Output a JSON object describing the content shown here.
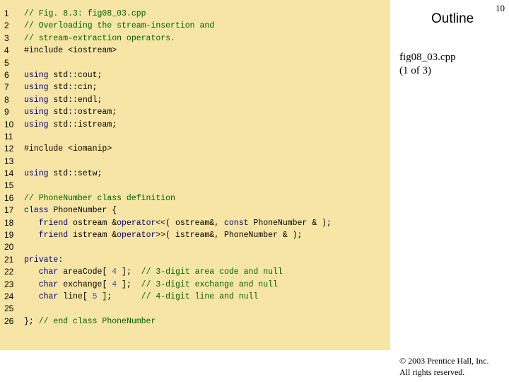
{
  "outline_label": "Outline",
  "page_number": "10",
  "file": {
    "name": "fig08_03.cpp",
    "part": "(1 of 3)"
  },
  "copyright": {
    "line1": "© 2003 Prentice Hall, Inc.",
    "line2": "All rights reserved."
  },
  "code_lines": [
    {
      "n": "1",
      "parts": [
        {
          "t": "// Fig. 8.3: fig08_03.cpp",
          "c": "comment"
        }
      ]
    },
    {
      "n": "2",
      "parts": [
        {
          "t": "// Overloading the stream-insertion and",
          "c": "comment"
        }
      ]
    },
    {
      "n": "3",
      "parts": [
        {
          "t": "// stream-extraction operators.",
          "c": "comment"
        }
      ]
    },
    {
      "n": "4",
      "parts": [
        {
          "t": "#include <iostream>",
          "c": ""
        }
      ]
    },
    {
      "n": "5",
      "parts": []
    },
    {
      "n": "6",
      "parts": [
        {
          "t": "using",
          "c": "kw"
        },
        {
          "t": " std::cout;",
          "c": ""
        }
      ]
    },
    {
      "n": "7",
      "parts": [
        {
          "t": "using",
          "c": "kw"
        },
        {
          "t": " std::cin;",
          "c": ""
        }
      ]
    },
    {
      "n": "8",
      "parts": [
        {
          "t": "using",
          "c": "kw"
        },
        {
          "t": " std::endl;",
          "c": ""
        }
      ]
    },
    {
      "n": "9",
      "parts": [
        {
          "t": "using",
          "c": "kw"
        },
        {
          "t": " std::ostream;",
          "c": ""
        }
      ]
    },
    {
      "n": "10",
      "parts": [
        {
          "t": "using",
          "c": "kw"
        },
        {
          "t": " std::istream;",
          "c": ""
        }
      ]
    },
    {
      "n": "11",
      "parts": []
    },
    {
      "n": "12",
      "parts": [
        {
          "t": "#include <iomanip>",
          "c": ""
        }
      ]
    },
    {
      "n": "13",
      "parts": []
    },
    {
      "n": "14",
      "parts": [
        {
          "t": "using",
          "c": "kw"
        },
        {
          "t": " std::setw;",
          "c": ""
        }
      ]
    },
    {
      "n": "15",
      "parts": []
    },
    {
      "n": "16",
      "parts": [
        {
          "t": "// PhoneNumber class definition",
          "c": "comment"
        }
      ]
    },
    {
      "n": "17",
      "parts": [
        {
          "t": "class",
          "c": "kw"
        },
        {
          "t": " PhoneNumber {",
          "c": ""
        }
      ]
    },
    {
      "n": "18",
      "parts": [
        {
          "t": "   ",
          "c": ""
        },
        {
          "t": "friend",
          "c": "kw"
        },
        {
          "t": " ostream &",
          "c": ""
        },
        {
          "t": "operator",
          "c": "kw"
        },
        {
          "t": "<<( ostream&, ",
          "c": ""
        },
        {
          "t": "const",
          "c": "kw"
        },
        {
          "t": " PhoneNumber & );",
          "c": ""
        }
      ]
    },
    {
      "n": "19",
      "parts": [
        {
          "t": "   ",
          "c": ""
        },
        {
          "t": "friend",
          "c": "kw"
        },
        {
          "t": " istream &",
          "c": ""
        },
        {
          "t": "operator",
          "c": "kw"
        },
        {
          "t": ">>( istream&, PhoneNumber & );",
          "c": ""
        }
      ]
    },
    {
      "n": "20",
      "parts": []
    },
    {
      "n": "21",
      "parts": [
        {
          "t": "private",
          "c": "kw"
        },
        {
          "t": ":",
          "c": ""
        }
      ]
    },
    {
      "n": "22",
      "parts": [
        {
          "t": "   ",
          "c": ""
        },
        {
          "t": "char",
          "c": "kw"
        },
        {
          "t": " areaCode[ ",
          "c": ""
        },
        {
          "t": "4",
          "c": "num"
        },
        {
          "t": " ];  ",
          "c": ""
        },
        {
          "t": "// 3-digit area code and null",
          "c": "comment"
        }
      ]
    },
    {
      "n": "23",
      "parts": [
        {
          "t": "   ",
          "c": ""
        },
        {
          "t": "char",
          "c": "kw"
        },
        {
          "t": " exchange[ ",
          "c": ""
        },
        {
          "t": "4",
          "c": "num"
        },
        {
          "t": " ];  ",
          "c": ""
        },
        {
          "t": "// 3-digit exchange and null",
          "c": "comment"
        }
      ]
    },
    {
      "n": "24",
      "parts": [
        {
          "t": "   ",
          "c": ""
        },
        {
          "t": "char",
          "c": "kw"
        },
        {
          "t": " line[ ",
          "c": ""
        },
        {
          "t": "5",
          "c": "num"
        },
        {
          "t": " ];      ",
          "c": ""
        },
        {
          "t": "// 4-digit line and null",
          "c": "comment"
        }
      ]
    },
    {
      "n": "25",
      "parts": []
    },
    {
      "n": "26",
      "parts": [
        {
          "t": "}; ",
          "c": ""
        },
        {
          "t": "// end class PhoneNumber",
          "c": "comment"
        }
      ]
    }
  ]
}
